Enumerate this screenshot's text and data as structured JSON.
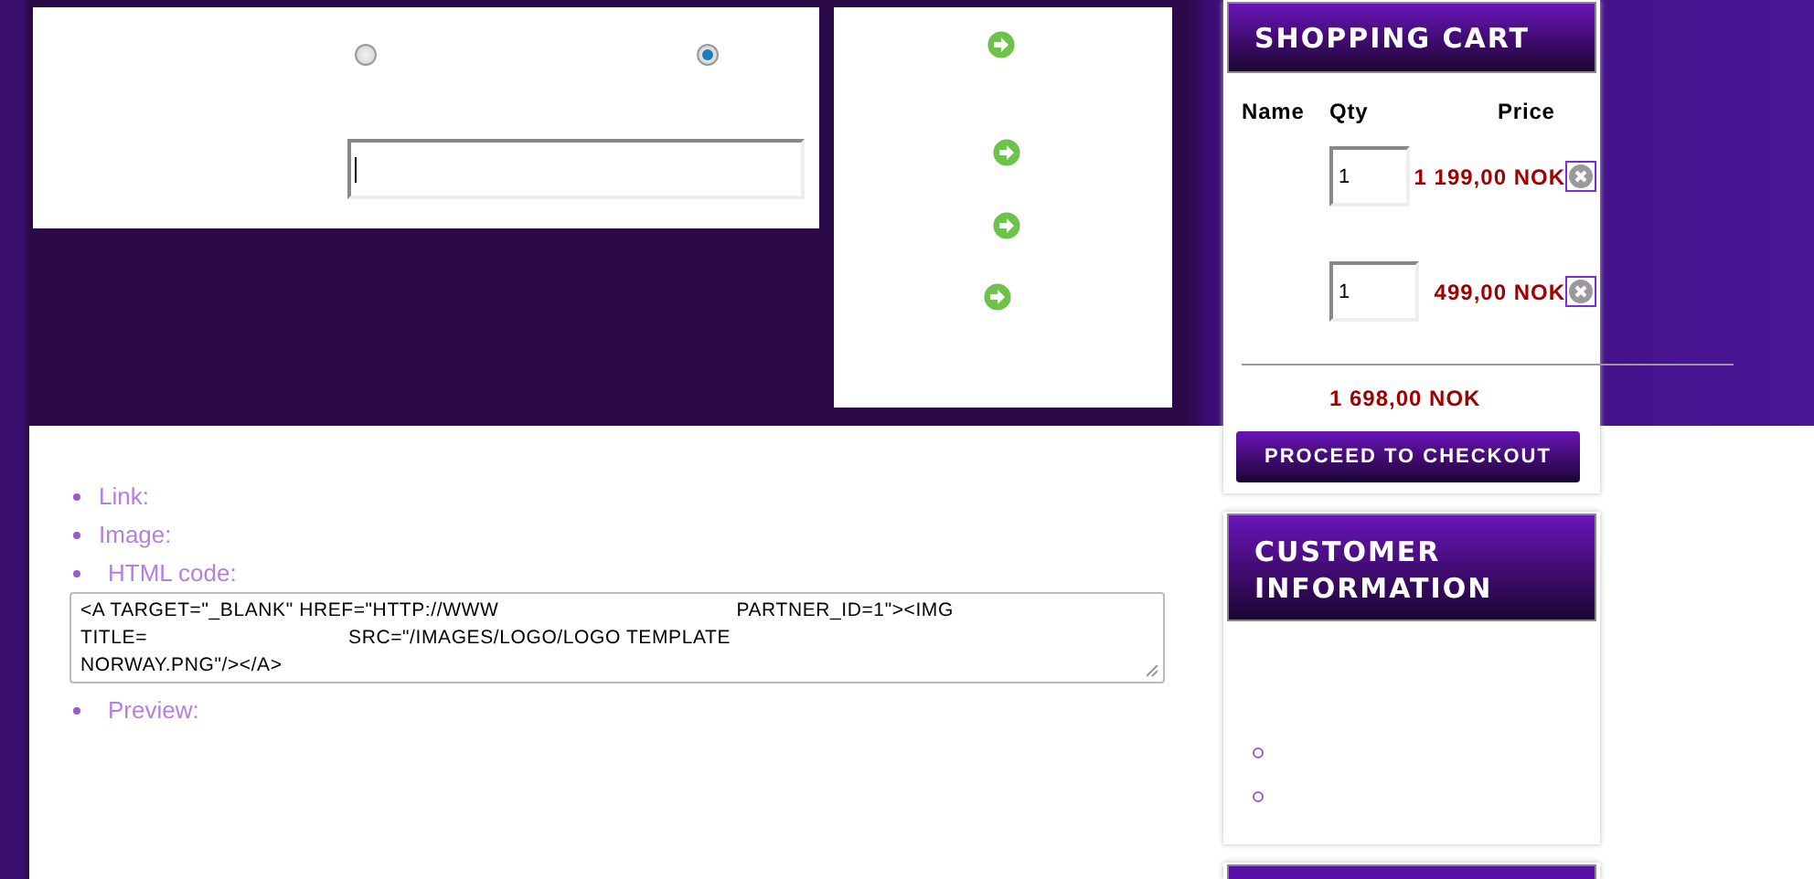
{
  "main_information": {
    "radios": [
      {
        "selected": false
      },
      {
        "selected": true
      }
    ]
  },
  "state": {
    "actions": [
      {
        "kind": "go"
      },
      {
        "kind": "go"
      },
      {
        "kind": "go"
      },
      {
        "kind": "go"
      }
    ]
  },
  "banner_samples": {
    "items": [
      {
        "kind": "label",
        "label": "Link:"
      },
      {
        "kind": "label",
        "label": "Image:"
      },
      {
        "kind": "code",
        "label": "HTML code:",
        "code_lines": [
          [
            "<A TARGET=\"_BLANK\" HREF=\"HTTP://WWW",
            "PARTNER_ID=1\"><IMG"
          ],
          [
            "TITLE=",
            "SRC=\"/IMAGES/LOGO/LOGO TEMPLATE"
          ],
          [
            "NORWAY.PNG\"/></A>"
          ]
        ]
      },
      {
        "kind": "label",
        "label": "Preview:"
      }
    ]
  },
  "shopping_cart": {
    "title": "SHOPPING CART",
    "columns": [
      "Name",
      "Qty",
      "Price"
    ],
    "rows": [
      {
        "qty": "1",
        "price": "1 199,00 NOK"
      },
      {
        "qty": "1",
        "price": "499,00 NOK"
      }
    ],
    "total": "1 698,00 NOK",
    "checkout": "PROCEED TO CHECKOUT"
  },
  "customer_information": {
    "title": "CUSTOMER INFORMATION",
    "items": [
      {
        "kind": "bullet"
      },
      {
        "kind": "bullet"
      }
    ]
  }
}
